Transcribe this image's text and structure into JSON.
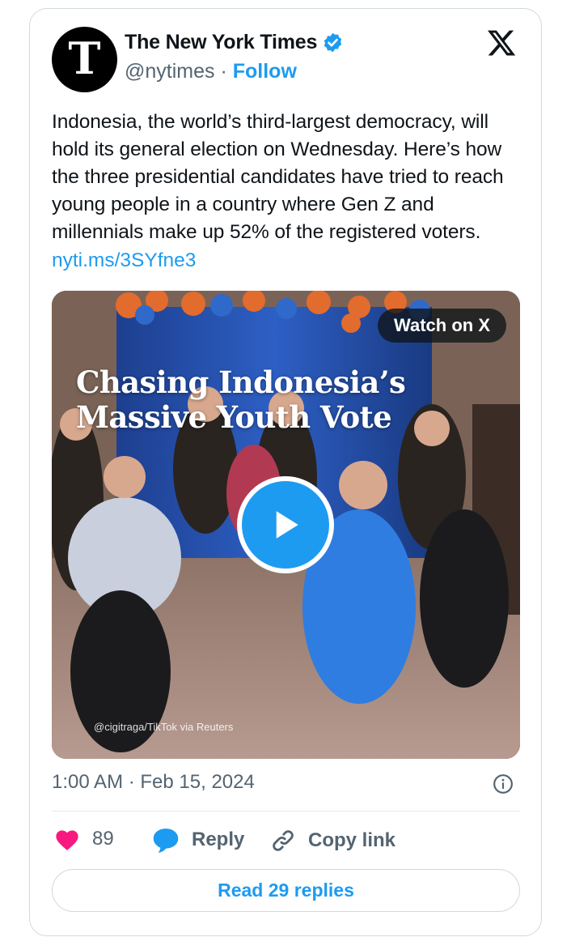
{
  "author": {
    "name": "The New York Times",
    "handle": "@nytimes",
    "separator": "·",
    "follow_label": "Follow",
    "avatar_glyph": "T",
    "verified": true,
    "verified_color": "#1d9bf0"
  },
  "platform_icon": "x-logo-icon",
  "tweet": {
    "text": "Indonesia, the world’s third-largest democracy, will hold its general election on Wednesday. Here’s how the three presidential candidates have tried to reach young people in a country where Gen Z and millennials make up 52% of the registered voters.",
    "link": "nyti.ms/3SYfne3"
  },
  "media": {
    "watch_label": "Watch on X",
    "headline_line1": "Chasing Indonesia’s",
    "headline_line2": "Massive Youth Vote",
    "credit": "@cigitraga/TikTok via Reuters",
    "play_icon": "play-icon"
  },
  "meta": {
    "timestamp": "1:00 AM · Feb 15, 2024",
    "info_icon": "info-icon"
  },
  "actions": {
    "like_count": "89",
    "reply_label": "Reply",
    "copy_label": "Copy link"
  },
  "read_replies_label": "Read 29 replies",
  "colors": {
    "accent": "#1d9bf0",
    "like": "#f91880",
    "text": "#0f1419",
    "muted": "#536471",
    "border": "#cfd9de"
  }
}
